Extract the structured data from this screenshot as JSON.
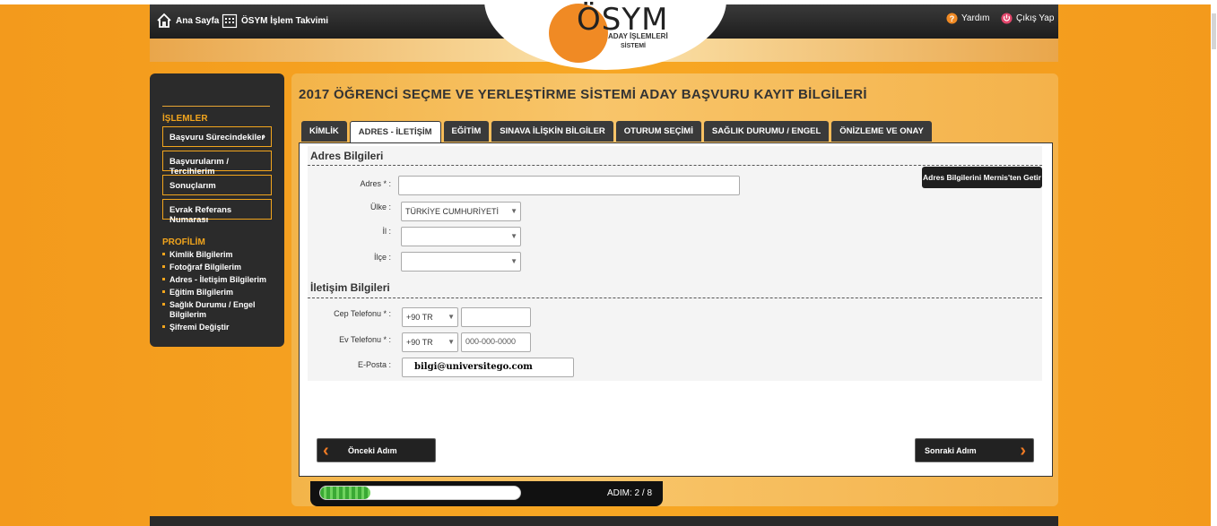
{
  "header": {
    "home_label": "Ana Sayfa",
    "calendar_label": "ÖSYM İşlem Takvimi",
    "help_label": "Yardım",
    "logout_label": "Çıkış Yap"
  },
  "logo": {
    "title": "ÖSYM",
    "sub1": "ADAY İŞLEMLERİ",
    "sub2": "SİSTEMİ"
  },
  "sidebar": {
    "section1": "İŞLEMLER",
    "buttons": [
      "Başvuru Sürecindekiler",
      "Başvurularım / Tercihlerim",
      "Sonuçlarım",
      "Evrak Referans Numarası"
    ],
    "section2": "PROFİLİM",
    "profile_links": [
      "Kimlik Bilgilerim",
      "Fotoğraf Bilgilerim",
      "Adres - İletişim Bilgilerim",
      "Eğitim Bilgilerim",
      "Sağlık Durumu / Engel Bilgilerim",
      "Şifremi Değiştir"
    ]
  },
  "main": {
    "title": "2017 ÖĞRENCİ SEÇME VE YERLEŞTİRME SİSTEMİ ADAY BAŞVURU KAYIT BİLGİLERİ",
    "tabs": [
      "KİMLİK",
      "ADRES - İLETİŞİM",
      "EĞİTİM",
      "SINAVA İLİŞKİN BİLGİLER",
      "OTURUM SEÇİMİ",
      "SAĞLIK DURUMU / ENGEL",
      "ÖNİZLEME VE ONAY"
    ],
    "active_tab": "ADRES - İLETİŞİM"
  },
  "address": {
    "section_title": "Adres Bilgileri",
    "adres_label": "Adres * :",
    "adres_value": "",
    "ulke_label": "Ülke :",
    "ulke_value": "TÜRKİYE CUMHURİYETİ",
    "il_label": "İl :",
    "il_value": "",
    "ilce_label": "İlçe :",
    "ilce_value": "",
    "memis_button": "Adres Bilgilerini Mernis'ten Getir"
  },
  "contact": {
    "section_title": "İletişim Bilgileri",
    "cep_label": "Cep Telefonu * :",
    "cep_code": "+90 TR",
    "cep_value": "",
    "ev_label": "Ev Telefonu * :",
    "ev_code": "+90 TR",
    "ev_placeholder": "000-000-0000",
    "email_label": "E-Posta :",
    "email_value": "bilgi@universitego.com"
  },
  "nav": {
    "prev_label": "Önceki Adım",
    "next_label": "Sonraki Adım"
  },
  "progress": {
    "step_label": "ADIM: 2 / 8",
    "fraction": 0.25
  },
  "colors": {
    "accent": "#f2a51d",
    "chevron": "#f07b24",
    "dark": "#2b2b2b"
  }
}
